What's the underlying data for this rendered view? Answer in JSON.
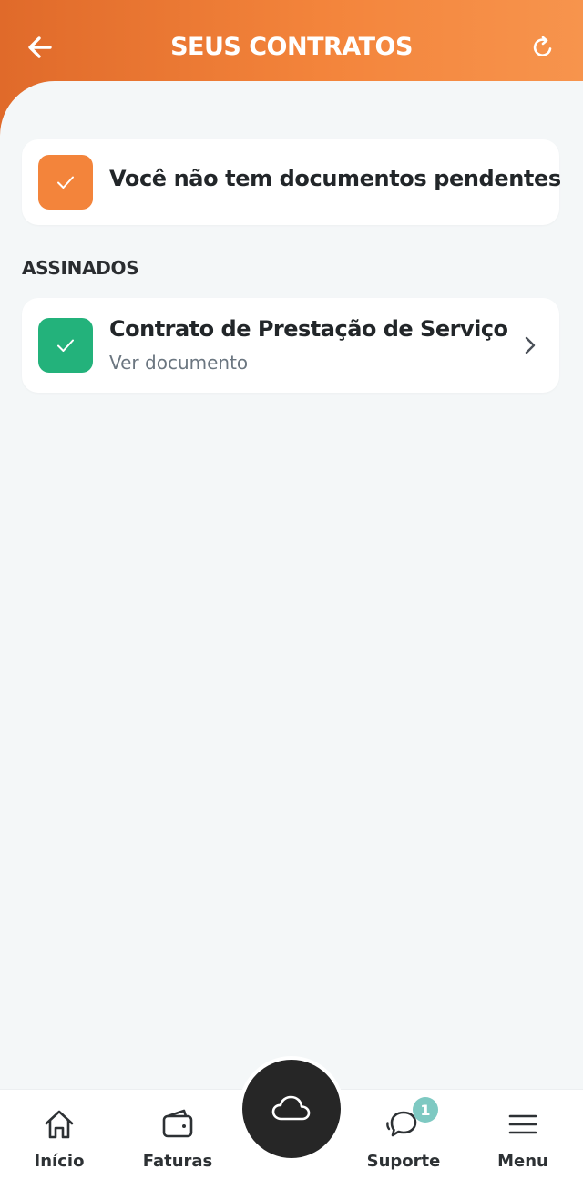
{
  "header": {
    "title": "SEUS CONTRATOS",
    "back_icon": "arrow-left-icon",
    "refresh_icon": "refresh-icon"
  },
  "pending": {
    "message": "Você não tem documentos pendentes",
    "icon_color": "#f3843b"
  },
  "signed_section": {
    "label": "ASSINADOS",
    "items": [
      {
        "title": "Contrato de Prestação de Serviço",
        "subtitle": "Ver documento",
        "icon_color": "#23b27b"
      }
    ]
  },
  "bottom_nav": {
    "items": [
      {
        "label": "Início",
        "icon": "home-icon"
      },
      {
        "label": "Faturas",
        "icon": "wallet-icon"
      },
      {
        "label": "Suporte",
        "icon": "chat-bubbles-icon",
        "badge": "1"
      },
      {
        "label": "Menu",
        "icon": "menu-icon"
      }
    ],
    "center_button_icon": "cloud-icon"
  },
  "colors": {
    "header_start": "#e06a2a",
    "header_end": "#f7944d",
    "background": "#f4f7f8",
    "badge": "#7ec9c2",
    "fab": "#262626"
  }
}
